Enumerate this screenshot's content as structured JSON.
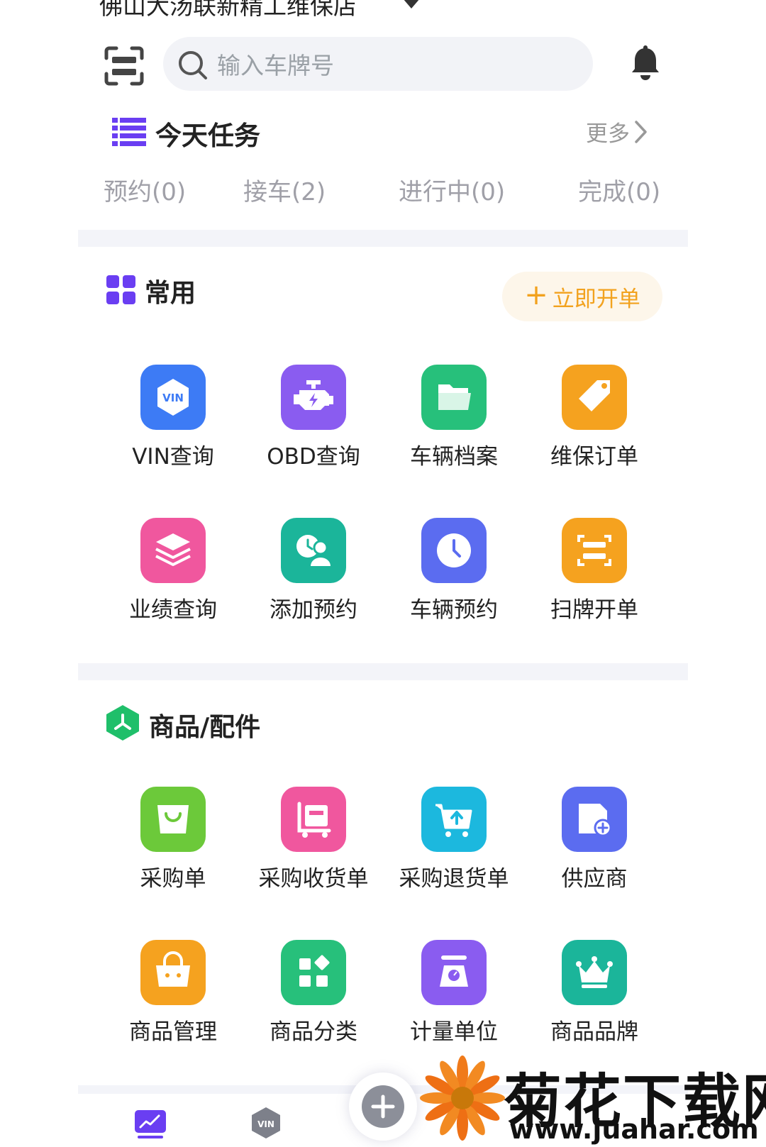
{
  "header": {
    "store_name": "佛山大汤联新精工维保店",
    "search_placeholder": "输入车牌号"
  },
  "tasks": {
    "title": "今天任务",
    "more": "更多",
    "tabs": [
      {
        "label": "预约(0)"
      },
      {
        "label": "接车(2)"
      },
      {
        "label": "进行中(0)"
      },
      {
        "label": "完成(0)"
      }
    ]
  },
  "common": {
    "title": "常用",
    "quick_order": "立即开单",
    "items": [
      {
        "label": "VIN查询",
        "icon": "vin-icon",
        "color": "#3d7bf5",
        "badge": "VIN"
      },
      {
        "label": "OBD查询",
        "icon": "engine-icon",
        "color": "#8a5cf0"
      },
      {
        "label": "车辆档案",
        "icon": "folder-icon",
        "color": "#27c07b"
      },
      {
        "label": "维保订单",
        "icon": "tag-icon",
        "color": "#f5a21f"
      },
      {
        "label": "业绩查询",
        "icon": "layers-icon",
        "color": "#f0579e"
      },
      {
        "label": "添加预约",
        "icon": "clock-user-icon",
        "color": "#1bb59a"
      },
      {
        "label": "车辆预约",
        "icon": "clock-icon",
        "color": "#5b6cf0"
      },
      {
        "label": "扫牌开单",
        "icon": "scan-icon",
        "color": "#f5a21f"
      }
    ]
  },
  "goods": {
    "title": "商品/配件",
    "items": [
      {
        "label": "采购单",
        "icon": "bag-icon",
        "color": "#6cc93a"
      },
      {
        "label": "采购收货单",
        "icon": "cart-receive-icon",
        "color": "#f0579e"
      },
      {
        "label": "采购退货单",
        "icon": "cart-return-icon",
        "color": "#1cb8de"
      },
      {
        "label": "供应商",
        "icon": "supplier-icon",
        "color": "#5b6cf0"
      },
      {
        "label": "商品管理",
        "icon": "basket-icon",
        "color": "#f5a21f"
      },
      {
        "label": "商品分类",
        "icon": "category-icon",
        "color": "#27c07b"
      },
      {
        "label": "计量单位",
        "icon": "scale-icon",
        "color": "#8a5cf0"
      },
      {
        "label": "商品品牌",
        "icon": "crown-icon",
        "color": "#1bb59a"
      }
    ]
  },
  "bottom_nav": {
    "vin_label": "VIN"
  },
  "watermark": {
    "title": "菊花下载网",
    "url": "www.juahar.com"
  }
}
